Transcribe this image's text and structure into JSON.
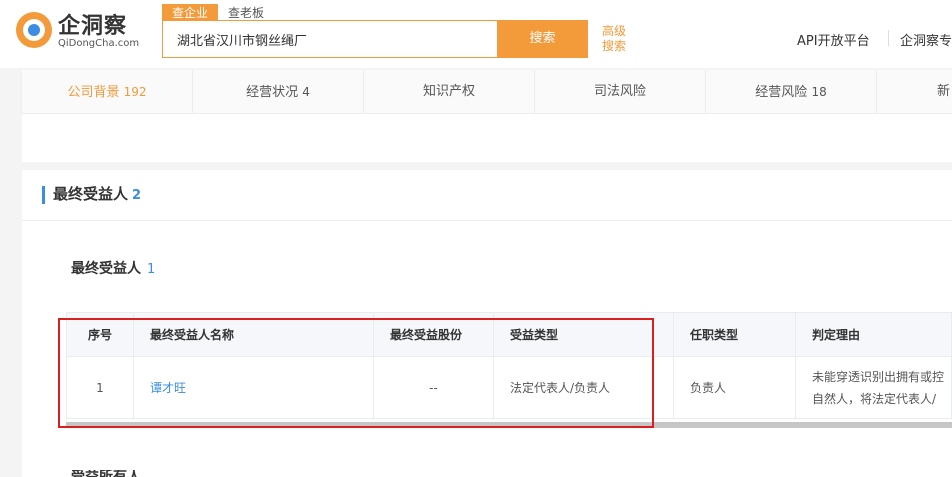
{
  "header": {
    "logo_text": "企洞察",
    "logo_sub": "QiDongCha.com",
    "search_tabs": [
      "查企业",
      "查老板"
    ],
    "search_value": "湖北省汉川市钢丝绳厂",
    "search_button": "搜索",
    "advanced_search": "高级搜索",
    "api_link": "API开放平台",
    "pro_link": "企洞察专"
  },
  "tabs": [
    {
      "label": "公司背景",
      "count": "192"
    },
    {
      "label": "经营状况",
      "count": "4"
    },
    {
      "label": "知识产权",
      "count": ""
    },
    {
      "label": "司法风险",
      "count": ""
    },
    {
      "label": "经营风险",
      "count": "18"
    },
    {
      "label": "新",
      "count": ""
    }
  ],
  "section": {
    "title": "最终受益人",
    "count": "2",
    "sub_title": "最终受益人",
    "sub_count": "1",
    "bottom_title": "受益所有人"
  },
  "table": {
    "headers": [
      "序号",
      "最终受益人名称",
      "最终受益股份",
      "受益类型",
      "任职类型",
      "判定理由"
    ],
    "rows": [
      {
        "index": "1",
        "name": "谭才旺",
        "share": "--",
        "benefit_type": "法定代表人/负责人",
        "position_type": "负责人",
        "reason_line1": "未能穿透识别出拥有或控",
        "reason_line2": "自然人，将法定代表人/"
      }
    ]
  },
  "colors": {
    "accent": "#f39a3a",
    "link": "#3a8de0",
    "highlight": "#d9201e"
  }
}
